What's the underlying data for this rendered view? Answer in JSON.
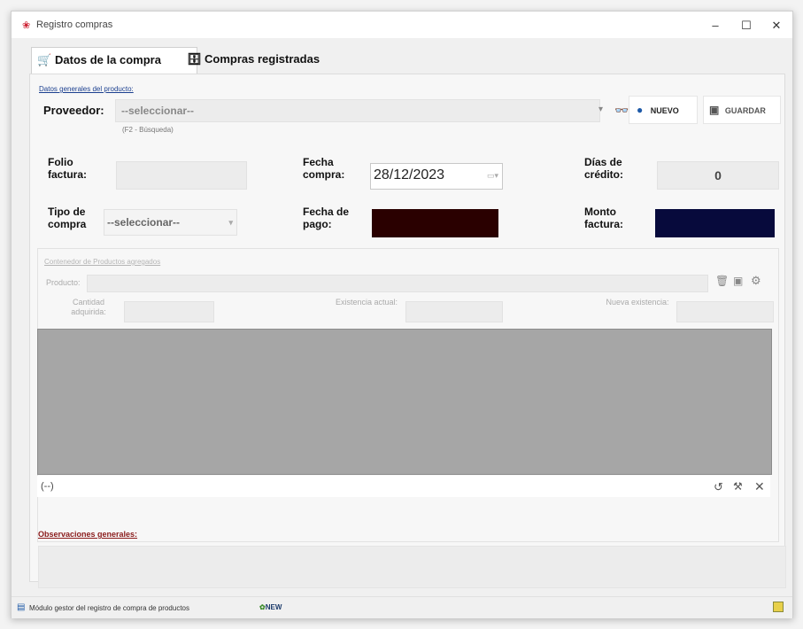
{
  "window": {
    "title": "Registro compras",
    "controls": [
      "–",
      "☐",
      "✕"
    ]
  },
  "tabs": [
    {
      "label": "Datos de la compra",
      "icon": "cart-icon"
    },
    {
      "label": "Compras registradas",
      "icon": "ledger-icon"
    }
  ],
  "general": {
    "section_title": "Datos generales del producto:",
    "supplier_label": "Proveedor:",
    "supplier_value": "--seleccionar--",
    "search_hint": "(F2 - Búsqueda)",
    "new_label": "NUEVO",
    "save_label": "GUARDAR"
  },
  "invoice": {
    "folio_label": "Folio factura:",
    "purchase_date_label": "Fecha compra:",
    "purchase_date_value": "28/12/2023",
    "credit_days_label": "Días de crédito:",
    "credit_days_value": "0",
    "purchase_type_label": "Tipo de compra",
    "purchase_type_value": "--seleccionar--",
    "payment_date_label": "Fecha de pago:",
    "invoice_amount_label": "Monto factura:",
    "colors": {
      "payment_date_fill": "#2a0000",
      "invoice_amount_fill": "#070a3c"
    }
  },
  "products": {
    "section_title": "Contenedor de Productos agregados",
    "product_label": "Producto:",
    "qty_label": "Cantidad adquirida:",
    "stock_label": "Existencia actual:",
    "new_stock_label": "Nueva existencia:",
    "nav_text": "(--)"
  },
  "observations": {
    "label": "Observaciones generales:"
  },
  "status": {
    "text": "Módulo gestor del registro de compra de productos",
    "badge": "NEW"
  }
}
